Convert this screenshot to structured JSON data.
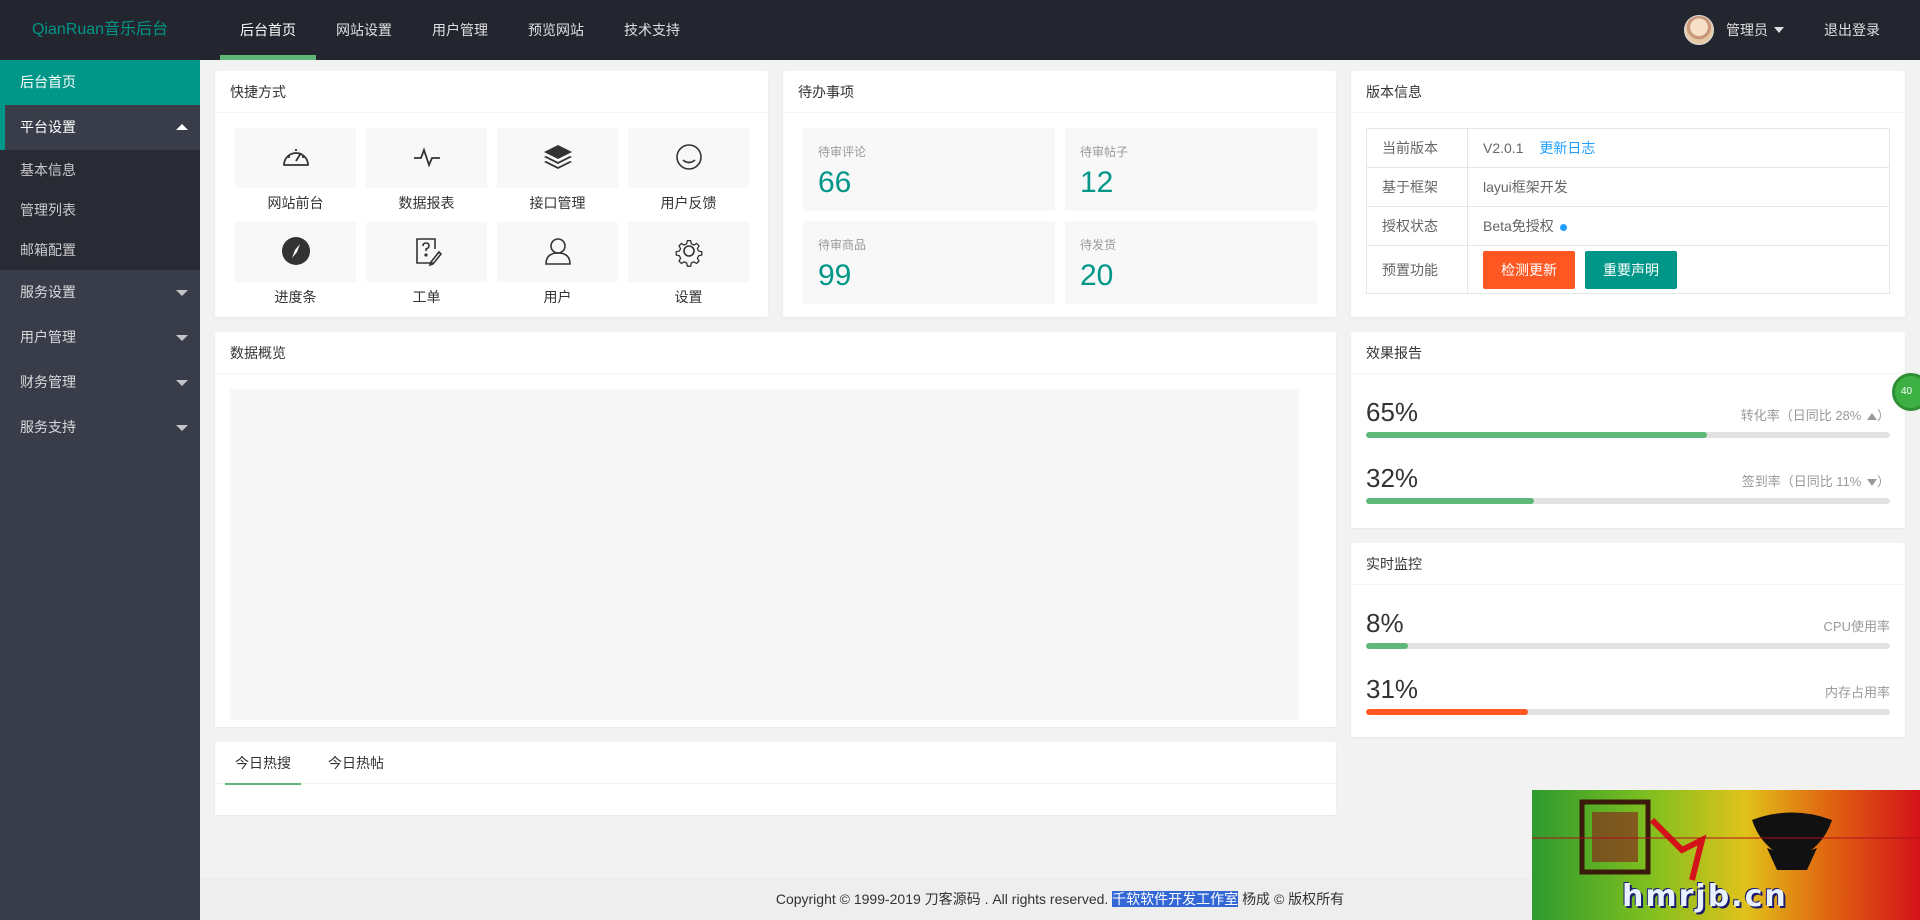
{
  "header": {
    "logo": "QianRuan音乐后台",
    "nav": [
      "后台首页",
      "网站设置",
      "用户管理",
      "预览网站",
      "技术支持"
    ],
    "user": "管理员",
    "logout": "退出登录"
  },
  "sidebar": {
    "items": [
      {
        "label": "后台首页"
      },
      {
        "label": "平台设置",
        "children": [
          "基本信息",
          "管理列表",
          "邮箱配置"
        ]
      },
      {
        "label": "服务设置"
      },
      {
        "label": "用户管理"
      },
      {
        "label": "财务管理"
      },
      {
        "label": "服务支持"
      }
    ]
  },
  "shortcuts": {
    "title": "快捷方式",
    "items": [
      {
        "label": "网站前台",
        "icon": "gauge-icon"
      },
      {
        "label": "数据报表",
        "icon": "heartbeat-icon"
      },
      {
        "label": "接口管理",
        "icon": "layers-icon"
      },
      {
        "label": "用户反馈",
        "icon": "smile-icon"
      },
      {
        "label": "进度条",
        "icon": "compass-icon"
      },
      {
        "label": "工单",
        "icon": "edit-icon"
      },
      {
        "label": "用户",
        "icon": "user-icon"
      },
      {
        "label": "设置",
        "icon": "gear-icon"
      }
    ]
  },
  "todo": {
    "title": "待办事项",
    "items": [
      {
        "label": "待审评论",
        "value": "66"
      },
      {
        "label": "待审帖子",
        "value": "12"
      },
      {
        "label": "待审商品",
        "value": "99"
      },
      {
        "label": "待发货",
        "value": "20"
      }
    ]
  },
  "version": {
    "title": "版本信息",
    "rows": {
      "current_key": "当前版本",
      "current_val": "V2.0.1",
      "changelog": "更新日志",
      "framework_key": "基于框架",
      "framework_val": "layui框架开发",
      "auth_key": "授权状态",
      "auth_val": "Beta免授权",
      "feature_key": "预置功能",
      "btn_check": "检测更新",
      "btn_notice": "重要声明"
    }
  },
  "overview": {
    "title": "数据概览"
  },
  "effect": {
    "title": "效果报告",
    "items": [
      {
        "value": "65%",
        "label": "转化率（日同比 28%",
        "trend": "up",
        "fill": 65,
        "color": "#5fb878"
      },
      {
        "value": "32%",
        "label": "签到率（日同比 11%",
        "trend": "down",
        "fill": 32,
        "color": "#5fb878"
      }
    ]
  },
  "monitor": {
    "title": "实时监控",
    "items": [
      {
        "value": "8%",
        "label": "CPU使用率",
        "fill": 8,
        "color": "#5fb878"
      },
      {
        "value": "31%",
        "label": "内存占用率",
        "fill": 31,
        "color": "#ff5722"
      }
    ]
  },
  "hot": {
    "tabs": [
      "今日热搜",
      "今日热帖"
    ]
  },
  "footer": {
    "prefix": "Copyright © 1999-2019 刀客源码 . All rights reserved.",
    "highlight": "千软软件开发工作室",
    "suffix": "杨成 © 版权所有"
  },
  "float_badge": "40",
  "watermark": {
    "text": "hmrjb.cn"
  }
}
